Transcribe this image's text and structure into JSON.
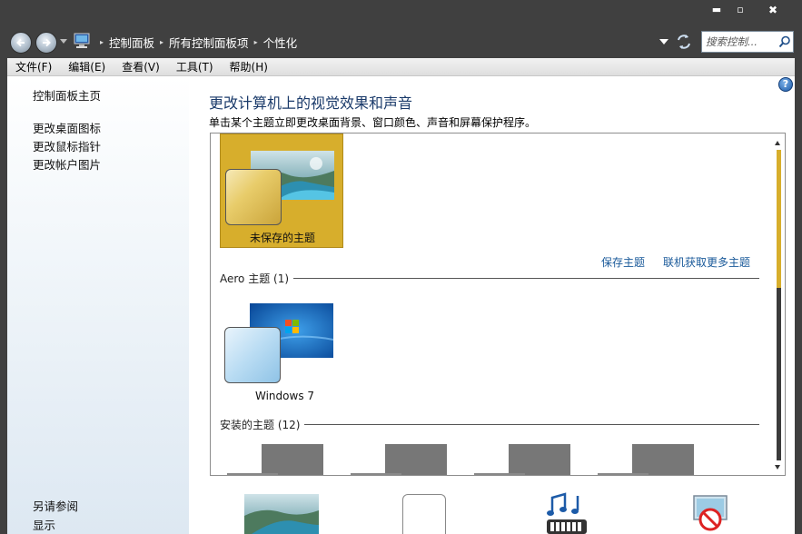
{
  "window": {
    "minimize_glyph": "▬",
    "maximize_glyph": "▫",
    "close_glyph": "✖"
  },
  "navigation": {
    "breadcrumbs": [
      "控制面板",
      "所有控制面板项",
      "个性化"
    ],
    "search_placeholder": "搜索控制..."
  },
  "menu": [
    "文件(F)",
    "编辑(E)",
    "查看(V)",
    "工具(T)",
    "帮助(H)"
  ],
  "sidebar": {
    "home": "控制面板主页",
    "links": [
      "更改桌面图标",
      "更改鼠标指针",
      "更改帐户图片"
    ],
    "see_also": "另请参阅",
    "bottom_links": [
      "显示"
    ]
  },
  "main": {
    "title": "更改计算机上的视觉效果和声音",
    "subtitle": "单击某个主题立即更改桌面背景、窗口颜色、声音和屏幕保护程序。",
    "help_glyph": "?",
    "unsaved_theme_label": "未保存的主题",
    "save_theme_link": "保存主题",
    "get_more_themes_link": "联机获取更多主题",
    "aero_section": "Aero 主题 (1)",
    "windows7_label": "Windows 7",
    "installed_section": "安装的主题 (12)"
  },
  "colors": {
    "selection": "#d7ae2c",
    "link": "#1a5a9a",
    "title_text": "#1a3a6a",
    "chrome": "#404040"
  },
  "icons": [
    "back-icon",
    "forward-icon",
    "control-panel-icon",
    "refresh-icon",
    "search-icon",
    "help-icon",
    "music-notes-icon",
    "screensaver-icon"
  ]
}
